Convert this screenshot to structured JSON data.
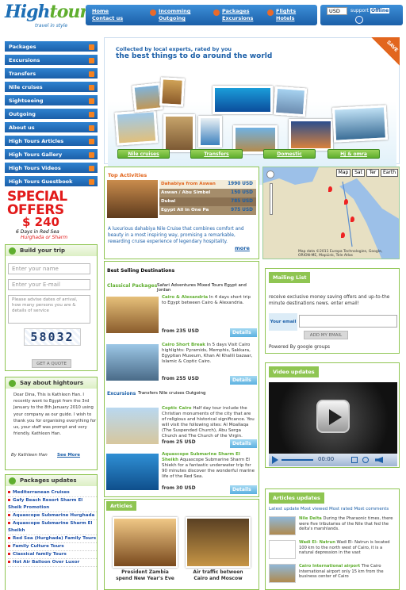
{
  "brand": {
    "logo_main": "High",
    "logo_accent": "tours",
    "tagline": "travel in style"
  },
  "nav": [
    {
      "top": "Home",
      "bottom": "Contact us"
    },
    {
      "top": "Incomming",
      "bottom": "Outgoing"
    },
    {
      "top": "Packages",
      "bottom": "Excursions"
    },
    {
      "top": "Flights",
      "bottom": "Hotels"
    }
  ],
  "topbar": {
    "currency": "USD",
    "support": "support",
    "status": "Offline"
  },
  "sidebar": {
    "items": [
      "Packages",
      "Excursions",
      "Transfers",
      "Nile cruises",
      "Sightseeing",
      "Outgoing",
      "About us",
      "High Tours Articles",
      "High Tours Gallery",
      "High Tours Videos",
      "High Tours Guestbook"
    ]
  },
  "offer": {
    "line1": "SPECIAL",
    "line2": "OFFERS",
    "price": "$ 240",
    "days": "6 Days in Red Sea",
    "place": "Hurghada or Sharm"
  },
  "build": {
    "title": "Build your trip",
    "name_placeholder": "Enter your name",
    "email_placeholder": "Enter your E-mail",
    "notes_placeholder": "Please advise dates of arrival, how many persons you are & details of service",
    "captcha": "58032",
    "button": "GET A QUOTE"
  },
  "say": {
    "title": "Say about hightours",
    "text": "Dear Dina, This is Kathleen Han. I recently went to Egypt from the 3rd January to the 8th January 2010 using your company as our guide. I wish to thank you for organising everything for us, your staff was prompt and very friendly. Kathleen Han.",
    "author": "By Kathleen Han",
    "more": "See More"
  },
  "packages_updates": {
    "title": "Packages updates",
    "items": [
      "Mediterranean Cruises",
      "Gafy Beach Resort Sharm El Sheik Promotion",
      "Aquascope Submarine Hurghada",
      "Aquascope Submarine Sharm El Sheikh",
      "Red Sea (Hurghada) Family Tours",
      "Family Culture Tours",
      "Classical family Tours",
      "Hot Air Balloon Over Luxor"
    ]
  },
  "hero": {
    "line1": "Collected by local experts, rated by you",
    "line2": "the best things to do around the world",
    "ribbon": "SAVE",
    "tabs": [
      "Nile cruises",
      "Transfers",
      "Domestic",
      "Hj & omra"
    ]
  },
  "top_activities": {
    "title": "Top Activities",
    "rows": [
      {
        "name": "Dahabiya from Aswan",
        "price": "1990 USD"
      },
      {
        "name": "Aswan / Abu Simbel",
        "price": "150 USD"
      },
      {
        "name": "Dubai",
        "price": "785 USD"
      },
      {
        "name": "Egypt All in One Pa",
        "price": "975 USD"
      }
    ],
    "description": "A luxurious dahabiya Nile Cruise that combines comfort and beauty in a most inspiring way, promising a remarkable, rewarding cruise experience of legendary hospitality.",
    "more": "more"
  },
  "map": {
    "buttons": [
      "Map",
      "Sat",
      "Ter",
      "Earth"
    ],
    "footer": "Map data ©2011 Europa Technologies, Google, ORION-ME, MapLink, Tele Atlas"
  },
  "best": {
    "title": "Best Selling Destinations",
    "classical_label": "Classical Packages",
    "classical_tabs": "Safari Adventures  Mixed Tours  Egypt and Jordan",
    "excursions_label": "Excursions",
    "excursions_tabs": "Transfers  Nile cruises  Outgoing",
    "tours": [
      {
        "title": "Cairo & Alexandria",
        "text": "In 4 days short trip to Egypt between Cairo & Alexandria.",
        "price": "from 235 USD"
      },
      {
        "title": "Cairo Short Break",
        "text": "In 5 days Visit Cairo highlights: Pyramids, Memphis, Sakkara, Egyptian Museum, Khan Al Khalili bazaar, Islamic & Coptic Cairo.",
        "price": "from 255 USD"
      },
      {
        "title": "Coptic Cairo",
        "text": "Half day tour include the Christian monuments of the city that are of religious and historical significance. You will visit the following sites: Al Moallaqa (The Suspended Church), Abu Serga Church and The Church of the Virgin.",
        "price": "from 25 USD"
      },
      {
        "title": "Aquascope Submarine Sharm El Sheikh",
        "text": "Aquascope Submarine Sharm El Shiekh for a fantastic underwater trip for 90 minutes discover the wonderful marine life of the Red Sea.",
        "price": "from 30 USD"
      }
    ],
    "details": "Details"
  },
  "mailing": {
    "title": "Mailing List",
    "text": "receive exclusive money saving offers and up-to-the minute destinations news. enter email!",
    "label": "Your email",
    "button": "ADD MY EMAIL",
    "powered": "Powered By google groups"
  },
  "video": {
    "title": "Video updates",
    "time": "00:00"
  },
  "articles_updates": {
    "title": "Articles updates",
    "tabs": "Latest update  Most viewed  Most rated  Most comments",
    "items": [
      {
        "title": "Nile Delta",
        "text": "During the Pharaonic times, there were five tributaries of the Nile that fed the delta's marshlands."
      },
      {
        "title": "Wadi El- Natrun",
        "text": "Wadi El- Natrun is located 100 km to the north west of Cairo, it is a natural depression in the vast"
      },
      {
        "title": "Cairo International airport",
        "text": "The Cairo International airport only 15 km from the business center of Cairo"
      }
    ]
  },
  "articles": {
    "title": "Articles",
    "items": [
      {
        "caption": "President Zambia spend New Year's Eve"
      },
      {
        "caption": "Air traffic between Cairo and Moscow"
      }
    ]
  }
}
